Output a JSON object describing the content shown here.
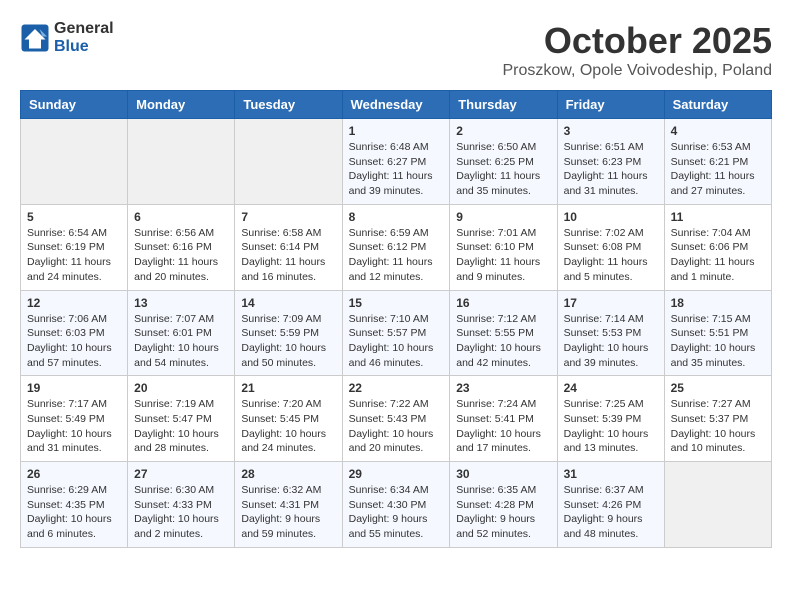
{
  "header": {
    "logo_general": "General",
    "logo_blue": "Blue",
    "month": "October 2025",
    "location": "Proszkow, Opole Voivodeship, Poland"
  },
  "weekdays": [
    "Sunday",
    "Monday",
    "Tuesday",
    "Wednesday",
    "Thursday",
    "Friday",
    "Saturday"
  ],
  "weeks": [
    [
      {
        "day": "",
        "info": ""
      },
      {
        "day": "",
        "info": ""
      },
      {
        "day": "",
        "info": ""
      },
      {
        "day": "1",
        "info": "Sunrise: 6:48 AM\nSunset: 6:27 PM\nDaylight: 11 hours\nand 39 minutes."
      },
      {
        "day": "2",
        "info": "Sunrise: 6:50 AM\nSunset: 6:25 PM\nDaylight: 11 hours\nand 35 minutes."
      },
      {
        "day": "3",
        "info": "Sunrise: 6:51 AM\nSunset: 6:23 PM\nDaylight: 11 hours\nand 31 minutes."
      },
      {
        "day": "4",
        "info": "Sunrise: 6:53 AM\nSunset: 6:21 PM\nDaylight: 11 hours\nand 27 minutes."
      }
    ],
    [
      {
        "day": "5",
        "info": "Sunrise: 6:54 AM\nSunset: 6:19 PM\nDaylight: 11 hours\nand 24 minutes."
      },
      {
        "day": "6",
        "info": "Sunrise: 6:56 AM\nSunset: 6:16 PM\nDaylight: 11 hours\nand 20 minutes."
      },
      {
        "day": "7",
        "info": "Sunrise: 6:58 AM\nSunset: 6:14 PM\nDaylight: 11 hours\nand 16 minutes."
      },
      {
        "day": "8",
        "info": "Sunrise: 6:59 AM\nSunset: 6:12 PM\nDaylight: 11 hours\nand 12 minutes."
      },
      {
        "day": "9",
        "info": "Sunrise: 7:01 AM\nSunset: 6:10 PM\nDaylight: 11 hours\nand 9 minutes."
      },
      {
        "day": "10",
        "info": "Sunrise: 7:02 AM\nSunset: 6:08 PM\nDaylight: 11 hours\nand 5 minutes."
      },
      {
        "day": "11",
        "info": "Sunrise: 7:04 AM\nSunset: 6:06 PM\nDaylight: 11 hours\nand 1 minute."
      }
    ],
    [
      {
        "day": "12",
        "info": "Sunrise: 7:06 AM\nSunset: 6:03 PM\nDaylight: 10 hours\nand 57 minutes."
      },
      {
        "day": "13",
        "info": "Sunrise: 7:07 AM\nSunset: 6:01 PM\nDaylight: 10 hours\nand 54 minutes."
      },
      {
        "day": "14",
        "info": "Sunrise: 7:09 AM\nSunset: 5:59 PM\nDaylight: 10 hours\nand 50 minutes."
      },
      {
        "day": "15",
        "info": "Sunrise: 7:10 AM\nSunset: 5:57 PM\nDaylight: 10 hours\nand 46 minutes."
      },
      {
        "day": "16",
        "info": "Sunrise: 7:12 AM\nSunset: 5:55 PM\nDaylight: 10 hours\nand 42 minutes."
      },
      {
        "day": "17",
        "info": "Sunrise: 7:14 AM\nSunset: 5:53 PM\nDaylight: 10 hours\nand 39 minutes."
      },
      {
        "day": "18",
        "info": "Sunrise: 7:15 AM\nSunset: 5:51 PM\nDaylight: 10 hours\nand 35 minutes."
      }
    ],
    [
      {
        "day": "19",
        "info": "Sunrise: 7:17 AM\nSunset: 5:49 PM\nDaylight: 10 hours\nand 31 minutes."
      },
      {
        "day": "20",
        "info": "Sunrise: 7:19 AM\nSunset: 5:47 PM\nDaylight: 10 hours\nand 28 minutes."
      },
      {
        "day": "21",
        "info": "Sunrise: 7:20 AM\nSunset: 5:45 PM\nDaylight: 10 hours\nand 24 minutes."
      },
      {
        "day": "22",
        "info": "Sunrise: 7:22 AM\nSunset: 5:43 PM\nDaylight: 10 hours\nand 20 minutes."
      },
      {
        "day": "23",
        "info": "Sunrise: 7:24 AM\nSunset: 5:41 PM\nDaylight: 10 hours\nand 17 minutes."
      },
      {
        "day": "24",
        "info": "Sunrise: 7:25 AM\nSunset: 5:39 PM\nDaylight: 10 hours\nand 13 minutes."
      },
      {
        "day": "25",
        "info": "Sunrise: 7:27 AM\nSunset: 5:37 PM\nDaylight: 10 hours\nand 10 minutes."
      }
    ],
    [
      {
        "day": "26",
        "info": "Sunrise: 6:29 AM\nSunset: 4:35 PM\nDaylight: 10 hours\nand 6 minutes."
      },
      {
        "day": "27",
        "info": "Sunrise: 6:30 AM\nSunset: 4:33 PM\nDaylight: 10 hours\nand 2 minutes."
      },
      {
        "day": "28",
        "info": "Sunrise: 6:32 AM\nSunset: 4:31 PM\nDaylight: 9 hours\nand 59 minutes."
      },
      {
        "day": "29",
        "info": "Sunrise: 6:34 AM\nSunset: 4:30 PM\nDaylight: 9 hours\nand 55 minutes."
      },
      {
        "day": "30",
        "info": "Sunrise: 6:35 AM\nSunset: 4:28 PM\nDaylight: 9 hours\nand 52 minutes."
      },
      {
        "day": "31",
        "info": "Sunrise: 6:37 AM\nSunset: 4:26 PM\nDaylight: 9 hours\nand 48 minutes."
      },
      {
        "day": "",
        "info": ""
      }
    ]
  ]
}
